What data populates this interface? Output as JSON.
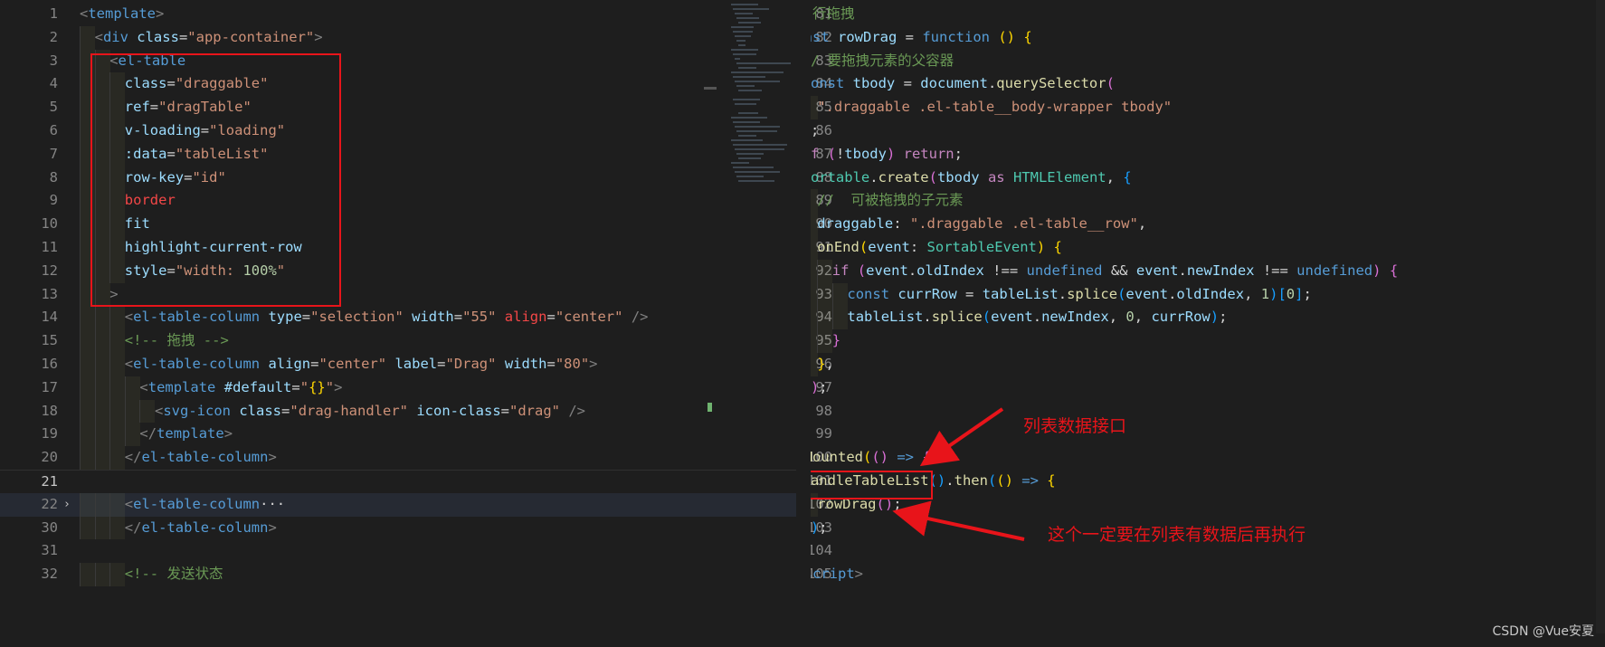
{
  "left_editor": {
    "lines": [
      {
        "n": "1",
        "tokens": [
          [
            "br",
            "<"
          ],
          [
            "tag",
            "template"
          ],
          [
            "br",
            ">"
          ]
        ],
        "indent": 0
      },
      {
        "n": "2",
        "tokens": [
          [
            "br",
            "<"
          ],
          [
            "tag",
            "div "
          ],
          [
            "attr",
            "class"
          ],
          [
            "pun",
            "="
          ],
          [
            "str",
            "\"app-container\""
          ],
          [
            "br",
            ">"
          ]
        ],
        "indent": 1
      },
      {
        "n": "3",
        "tokens": [
          [
            "br",
            "<"
          ],
          [
            "tag",
            "el-table"
          ]
        ],
        "indent": 2
      },
      {
        "n": "4",
        "tokens": [
          [
            "attr",
            "class"
          ],
          [
            "pun",
            "="
          ],
          [
            "str",
            "\"draggable\""
          ]
        ],
        "indent": 3
      },
      {
        "n": "5",
        "tokens": [
          [
            "attr",
            "ref"
          ],
          [
            "pun",
            "="
          ],
          [
            "str",
            "\"dragTable\""
          ]
        ],
        "indent": 3
      },
      {
        "n": "6",
        "tokens": [
          [
            "attr",
            "v-loading"
          ],
          [
            "pun",
            "="
          ],
          [
            "str",
            "\"loading\""
          ]
        ],
        "indent": 3
      },
      {
        "n": "7",
        "tokens": [
          [
            "attr",
            ":data"
          ],
          [
            "pun",
            "="
          ],
          [
            "str",
            "\"tableList\""
          ]
        ],
        "indent": 3
      },
      {
        "n": "8",
        "tokens": [
          [
            "attr",
            "row-key"
          ],
          [
            "pun",
            "="
          ],
          [
            "str",
            "\"id\""
          ]
        ],
        "indent": 3
      },
      {
        "n": "9",
        "tokens": [
          [
            "red",
            "border"
          ]
        ],
        "indent": 3
      },
      {
        "n": "10",
        "tokens": [
          [
            "attr",
            "fit"
          ]
        ],
        "indent": 3
      },
      {
        "n": "11",
        "tokens": [
          [
            "attr",
            "highlight-current-row"
          ]
        ],
        "indent": 3
      },
      {
        "n": "12",
        "tokens": [
          [
            "attr",
            "style"
          ],
          [
            "pun",
            "="
          ],
          [
            "str",
            "\"width: "
          ],
          [
            "num",
            "100%"
          ],
          [
            "str",
            "\""
          ]
        ],
        "indent": 3
      },
      {
        "n": "13",
        "tokens": [
          [
            "br",
            ">"
          ]
        ],
        "indent": 2
      },
      {
        "n": "14",
        "tokens": [
          [
            "br",
            "<"
          ],
          [
            "tag",
            "el-table-column "
          ],
          [
            "attr",
            "type"
          ],
          [
            "pun",
            "="
          ],
          [
            "str",
            "\"selection\" "
          ],
          [
            "attr",
            "width"
          ],
          [
            "pun",
            "="
          ],
          [
            "str",
            "\"55\" "
          ],
          [
            "red",
            "align"
          ],
          [
            "pun",
            "="
          ],
          [
            "str",
            "\"center\" "
          ],
          [
            "br",
            "/>"
          ]
        ],
        "indent": 3
      },
      {
        "n": "15",
        "tokens": [
          [
            "com",
            "<!-- 拖拽 -->"
          ]
        ],
        "indent": 3
      },
      {
        "n": "16",
        "tokens": [
          [
            "br",
            "<"
          ],
          [
            "tag",
            "el-table-column "
          ],
          [
            "attr",
            "align"
          ],
          [
            "pun",
            "="
          ],
          [
            "str",
            "\"center\" "
          ],
          [
            "attr",
            "label"
          ],
          [
            "pun",
            "="
          ],
          [
            "str",
            "\"Drag\" "
          ],
          [
            "attr",
            "width"
          ],
          [
            "pun",
            "="
          ],
          [
            "str",
            "\"80\""
          ],
          [
            "br",
            ">"
          ]
        ],
        "indent": 3
      },
      {
        "n": "17",
        "tokens": [
          [
            "br",
            "<"
          ],
          [
            "tag",
            "template "
          ],
          [
            "attr",
            "#default"
          ],
          [
            "pun",
            "="
          ],
          [
            "str",
            "\""
          ],
          [
            "gold",
            "{}"
          ],
          [
            "str",
            "\""
          ],
          [
            "br",
            ">"
          ]
        ],
        "indent": 4
      },
      {
        "n": "18",
        "tokens": [
          [
            "br",
            "<"
          ],
          [
            "tag",
            "svg-icon "
          ],
          [
            "attr",
            "class"
          ],
          [
            "pun",
            "="
          ],
          [
            "str",
            "\"drag-handler\" "
          ],
          [
            "attr",
            "icon-class"
          ],
          [
            "pun",
            "="
          ],
          [
            "str",
            "\"drag\" "
          ],
          [
            "br",
            "/>"
          ]
        ],
        "indent": 5
      },
      {
        "n": "19",
        "tokens": [
          [
            "br",
            "</"
          ],
          [
            "tag",
            "template"
          ],
          [
            "br",
            ">"
          ]
        ],
        "indent": 4
      },
      {
        "n": "20",
        "tokens": [
          [
            "br",
            "</"
          ],
          [
            "tag",
            "el-table-column"
          ],
          [
            "br",
            ">"
          ]
        ],
        "indent": 3
      },
      {
        "n": "21",
        "tokens": [],
        "indent": 0,
        "active": true
      },
      {
        "n": "22",
        "tokens": [
          [
            "br",
            "<"
          ],
          [
            "tag",
            "el-table-column"
          ],
          [
            "pun",
            "···"
          ]
        ],
        "indent": 3,
        "fold": "›"
      },
      {
        "n": "30",
        "tokens": [
          [
            "br",
            "</"
          ],
          [
            "tag",
            "el-table-column"
          ],
          [
            "br",
            ">"
          ]
        ],
        "indent": 3
      },
      {
        "n": "31",
        "tokens": [],
        "indent": 0
      },
      {
        "n": "32",
        "tokens": [
          [
            "com",
            "<!-- 发送状态"
          ]
        ],
        "indent": 3
      }
    ]
  },
  "right_editor": {
    "lines": [
      {
        "n": "81",
        "tokens": [
          [
            "com",
            "// 行拖拽"
          ]
        ],
        "indent": 0
      },
      {
        "n": "82",
        "tokens": [
          [
            "kw",
            "const "
          ],
          [
            "var",
            "rowDrag "
          ],
          [
            "pun",
            "= "
          ],
          [
            "kw",
            "function "
          ],
          [
            "gold",
            "() {"
          ]
        ],
        "indent": 0
      },
      {
        "n": "83",
        "tokens": [
          [
            "com",
            "// 要拖拽元素的父容器"
          ]
        ],
        "indent": 1
      },
      {
        "n": "84",
        "tokens": [
          [
            "kw",
            "const "
          ],
          [
            "var",
            "tbody "
          ],
          [
            "pun",
            "= "
          ],
          [
            "var",
            "document"
          ],
          [
            "pun",
            "."
          ],
          [
            "fn",
            "querySelector"
          ],
          [
            "pink",
            "("
          ]
        ],
        "indent": 1
      },
      {
        "n": "85",
        "tokens": [
          [
            "str",
            "\".draggable .el-table__body-wrapper tbody\""
          ]
        ],
        "indent": 2
      },
      {
        "n": "86",
        "tokens": [
          [
            "pink",
            ")"
          ],
          [
            "pun",
            ";"
          ]
        ],
        "indent": 1
      },
      {
        "n": "87",
        "tokens": [
          [
            "ctl",
            "if "
          ],
          [
            "pink",
            "("
          ],
          [
            "pun",
            "!"
          ],
          [
            "var",
            "tbody"
          ],
          [
            "pink",
            ") "
          ],
          [
            "ctl",
            "return"
          ],
          [
            "pun",
            ";"
          ]
        ],
        "indent": 1
      },
      {
        "n": "88",
        "tokens": [
          [
            "type",
            "Sortable"
          ],
          [
            "pun",
            "."
          ],
          [
            "fn",
            "create"
          ],
          [
            "pink",
            "("
          ],
          [
            "var",
            "tbody "
          ],
          [
            "ctl",
            "as "
          ],
          [
            "type",
            "HTMLElement"
          ],
          [
            "pun",
            ", "
          ],
          [
            "blue",
            "{"
          ]
        ],
        "indent": 1
      },
      {
        "n": "89",
        "tokens": [
          [
            "com",
            "//  可被拖拽的子元素"
          ]
        ],
        "indent": 2
      },
      {
        "n": "90",
        "tokens": [
          [
            "var",
            "draggable"
          ],
          [
            "pun",
            ": "
          ],
          [
            "str",
            "\".draggable .el-table__row\""
          ],
          [
            "pun",
            ","
          ]
        ],
        "indent": 2
      },
      {
        "n": "91",
        "tokens": [
          [
            "fn",
            "onEnd"
          ],
          [
            "gold",
            "("
          ],
          [
            "var",
            "event"
          ],
          [
            "pun",
            ": "
          ],
          [
            "type",
            "SortableEvent"
          ],
          [
            "gold",
            ") "
          ],
          [
            "gold",
            "{"
          ]
        ],
        "indent": 2
      },
      {
        "n": "92",
        "tokens": [
          [
            "ctl",
            "if "
          ],
          [
            "pink",
            "("
          ],
          [
            "var",
            "event"
          ],
          [
            "pun",
            "."
          ],
          [
            "var",
            "oldIndex "
          ],
          [
            "pun",
            "!== "
          ],
          [
            "kw",
            "undefined "
          ],
          [
            "pun",
            "&& "
          ],
          [
            "var",
            "event"
          ],
          [
            "pun",
            "."
          ],
          [
            "var",
            "newIndex "
          ],
          [
            "pun",
            "!== "
          ],
          [
            "kw",
            "undefined"
          ],
          [
            "pink",
            ") "
          ],
          [
            "pink",
            "{"
          ]
        ],
        "indent": 3
      },
      {
        "n": "93",
        "tokens": [
          [
            "kw",
            "const "
          ],
          [
            "var",
            "currRow "
          ],
          [
            "pun",
            "= "
          ],
          [
            "var",
            "tableList"
          ],
          [
            "pun",
            "."
          ],
          [
            "fn",
            "splice"
          ],
          [
            "blue",
            "("
          ],
          [
            "var",
            "event"
          ],
          [
            "pun",
            "."
          ],
          [
            "var",
            "oldIndex"
          ],
          [
            "pun",
            ", "
          ],
          [
            "num",
            "1"
          ],
          [
            "blue",
            ")"
          ],
          [
            "blue",
            "["
          ],
          [
            "num",
            "0"
          ],
          [
            "blue",
            "]"
          ],
          [
            "pun",
            ";"
          ]
        ],
        "indent": 4
      },
      {
        "n": "94",
        "tokens": [
          [
            "var",
            "tableList"
          ],
          [
            "pun",
            "."
          ],
          [
            "fn",
            "splice"
          ],
          [
            "blue",
            "("
          ],
          [
            "var",
            "event"
          ],
          [
            "pun",
            "."
          ],
          [
            "var",
            "newIndex"
          ],
          [
            "pun",
            ", "
          ],
          [
            "num",
            "0"
          ],
          [
            "pun",
            ", "
          ],
          [
            "var",
            "currRow"
          ],
          [
            "blue",
            ")"
          ],
          [
            "pun",
            ";"
          ]
        ],
        "indent": 4
      },
      {
        "n": "95",
        "tokens": [
          [
            "pink",
            "}"
          ]
        ],
        "indent": 3
      },
      {
        "n": "96",
        "tokens": [
          [
            "gold",
            "}"
          ],
          [
            "pun",
            ","
          ]
        ],
        "indent": 2
      },
      {
        "n": "97",
        "tokens": [
          [
            "blue",
            "}"
          ],
          [
            "pink",
            ")"
          ],
          [
            "pun",
            ";"
          ]
        ],
        "indent": 1
      },
      {
        "n": "98",
        "tokens": [
          [
            "gold",
            "}"
          ],
          [
            "pun",
            ";"
          ]
        ],
        "indent": 0
      },
      {
        "n": "99",
        "tokens": [],
        "indent": 0
      },
      {
        "n": "100",
        "tokens": [
          [
            "fn",
            "onMounted"
          ],
          [
            "gold",
            "("
          ],
          [
            "pink",
            "() "
          ],
          [
            "kw",
            "=> "
          ],
          [
            "pink",
            "{"
          ]
        ],
        "indent": 0
      },
      {
        "n": "101",
        "tokens": [
          [
            "fn",
            "handleTableList"
          ],
          [
            "blue",
            "()"
          ],
          [
            "pun",
            "."
          ],
          [
            "fn",
            "then"
          ],
          [
            "blue",
            "("
          ],
          [
            "gold",
            "() "
          ],
          [
            "kw",
            "=> "
          ],
          [
            "gold",
            "{"
          ]
        ],
        "indent": 1
      },
      {
        "n": "102",
        "tokens": [
          [
            "fn",
            "rowDrag"
          ],
          [
            "pink",
            "()"
          ],
          [
            "pun",
            ";"
          ]
        ],
        "indent": 2
      },
      {
        "n": "103",
        "tokens": [
          [
            "gold",
            "}"
          ],
          [
            "blue",
            ")"
          ],
          [
            "pun",
            ";"
          ]
        ],
        "indent": 1
      },
      {
        "n": "104",
        "tokens": [
          [
            "pink",
            "}"
          ],
          [
            "gold",
            ")"
          ],
          [
            "pun",
            ";"
          ]
        ],
        "indent": 0
      },
      {
        "n": "105",
        "tokens": [
          [
            "br",
            "</"
          ],
          [
            "tag",
            "script"
          ],
          [
            "br",
            ">"
          ]
        ],
        "indent": 0
      }
    ]
  },
  "annotations": {
    "api_label": "列表数据接口",
    "note_label": "这个一定要在列表有数据后再执行"
  },
  "watermark": "CSDN @Vue安夏",
  "colors": {
    "annotation_red": "#e8141a"
  }
}
